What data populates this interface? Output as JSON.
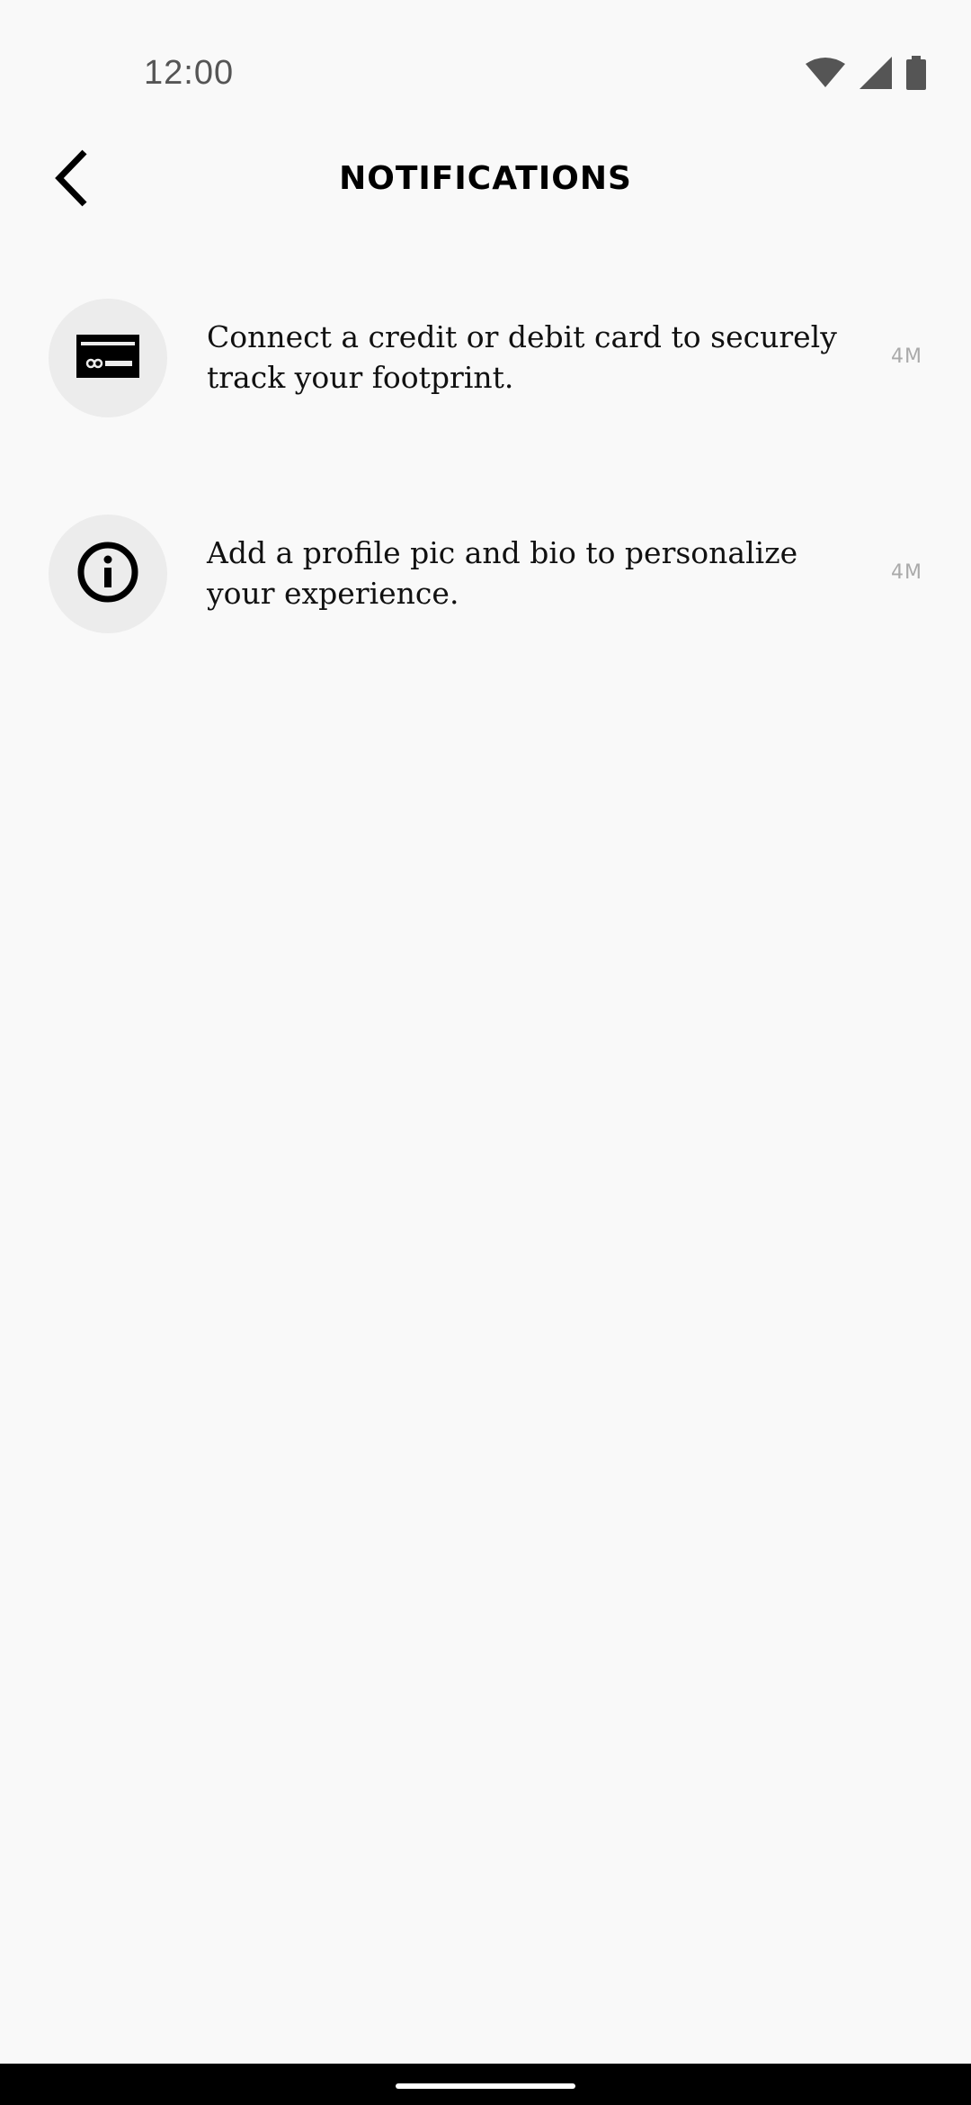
{
  "status_bar": {
    "time": "12:00",
    "icons": [
      "wifi-icon",
      "signal-icon",
      "battery-icon"
    ]
  },
  "header": {
    "title": "NOTIFICATIONS",
    "back_icon": "chevron-left-icon"
  },
  "notifications": [
    {
      "icon": "credit-card-icon",
      "text": "Connect a credit or debit card to securely track your footprint.",
      "time": "4M"
    },
    {
      "icon": "info-icon",
      "text": "Add a profile pic and bio to personalize your experience.",
      "time": "4M"
    }
  ],
  "colors": {
    "background": "#f9f9f9",
    "icon_circle": "#ececec",
    "text": "#111111",
    "timestamp": "#aaaaaa"
  }
}
